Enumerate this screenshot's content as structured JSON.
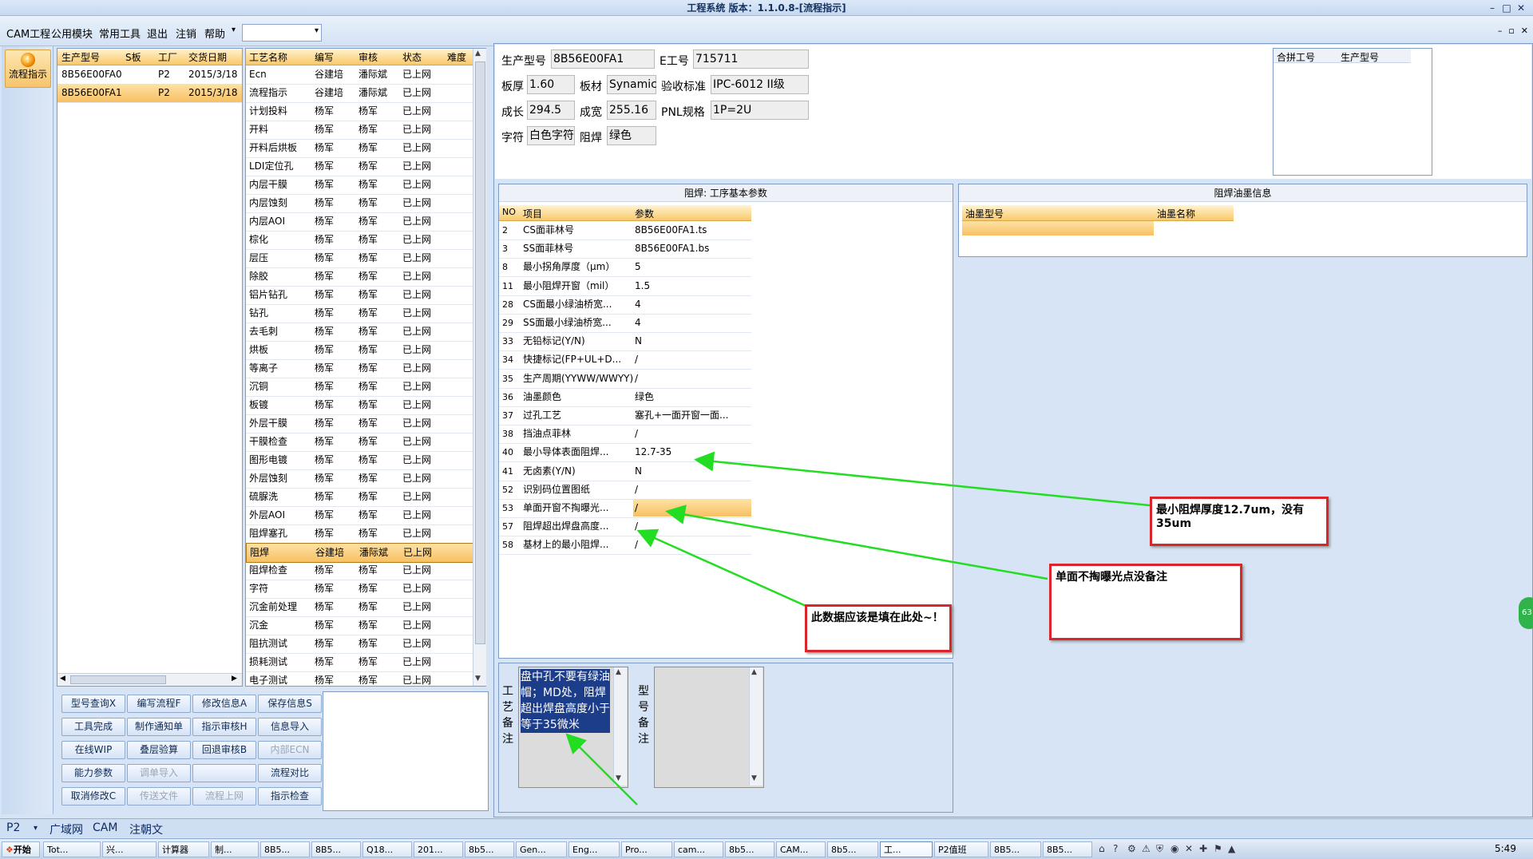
{
  "window": {
    "title": "工程系统 版本：1.1.0.8-[流程指示]"
  },
  "menu": {
    "items": [
      "CAM工程",
      "公用模块",
      "常用工具",
      "退出",
      "注销",
      "帮助"
    ],
    "combo_value": ""
  },
  "nav": {
    "label": "流程指示",
    "icon": "warning-orb-icon"
  },
  "product_list": {
    "headers": [
      "生产型号",
      "S板",
      "工厂",
      "交货日期"
    ],
    "rows": [
      [
        "8B56E00FA0",
        "",
        "P2",
        "2015/3/18"
      ],
      [
        "8B56E00FA1",
        "",
        "P2",
        "2015/3/18"
      ]
    ],
    "selected_index": 1
  },
  "process_list": {
    "headers": [
      "工艺名称",
      "编写",
      "审核",
      "状态",
      "难度"
    ],
    "rows": [
      [
        "Ecn",
        "谷建培",
        "潘际斌",
        "已上网"
      ],
      [
        "流程指示",
        "谷建培",
        "潘际斌",
        "已上网"
      ],
      [
        "计划投料",
        "杨军",
        "杨军",
        "已上网"
      ],
      [
        "开料",
        "杨军",
        "杨军",
        "已上网"
      ],
      [
        "开料后烘板",
        "杨军",
        "杨军",
        "已上网"
      ],
      [
        "LDI定位孔",
        "杨军",
        "杨军",
        "已上网"
      ],
      [
        "内层干膜",
        "杨军",
        "杨军",
        "已上网"
      ],
      [
        "内层蚀刻",
        "杨军",
        "杨军",
        "已上网"
      ],
      [
        "内层AOI",
        "杨军",
        "杨军",
        "已上网"
      ],
      [
        "棕化",
        "杨军",
        "杨军",
        "已上网"
      ],
      [
        "层压",
        "杨军",
        "杨军",
        "已上网"
      ],
      [
        "除胶",
        "杨军",
        "杨军",
        "已上网"
      ],
      [
        "铝片钻孔",
        "杨军",
        "杨军",
        "已上网"
      ],
      [
        "钻孔",
        "杨军",
        "杨军",
        "已上网"
      ],
      [
        "去毛刺",
        "杨军",
        "杨军",
        "已上网"
      ],
      [
        "烘板",
        "杨军",
        "杨军",
        "已上网"
      ],
      [
        "等离子",
        "杨军",
        "杨军",
        "已上网"
      ],
      [
        "沉铜",
        "杨军",
        "杨军",
        "已上网"
      ],
      [
        "板镀",
        "杨军",
        "杨军",
        "已上网"
      ],
      [
        "外层干膜",
        "杨军",
        "杨军",
        "已上网"
      ],
      [
        "干膜检查",
        "杨军",
        "杨军",
        "已上网"
      ],
      [
        "图形电镀",
        "杨军",
        "杨军",
        "已上网"
      ],
      [
        "外层蚀刻",
        "杨军",
        "杨军",
        "已上网"
      ],
      [
        "硫脲洗",
        "杨军",
        "杨军",
        "已上网"
      ],
      [
        "外层AOI",
        "杨军",
        "杨军",
        "已上网"
      ],
      [
        "阻焊塞孔",
        "杨军",
        "杨军",
        "已上网"
      ],
      [
        "阻焊",
        "谷建培",
        "潘际斌",
        "已上网"
      ],
      [
        "阻焊检查",
        "杨军",
        "杨军",
        "已上网"
      ],
      [
        "字符",
        "杨军",
        "杨军",
        "已上网"
      ],
      [
        "沉金前处理",
        "杨军",
        "杨军",
        "已上网"
      ],
      [
        "沉金",
        "杨军",
        "杨军",
        "已上网"
      ],
      [
        "阻抗测试",
        "杨军",
        "杨军",
        "已上网"
      ],
      [
        "损耗测试",
        "杨军",
        "杨军",
        "已上网"
      ],
      [
        "电子测试",
        "杨军",
        "杨军",
        "已上网"
      ]
    ],
    "selected_index": 26
  },
  "buttons": [
    [
      {
        "label": "型号查询X"
      },
      {
        "label": "编写流程F"
      },
      {
        "label": "修改信息A"
      },
      {
        "label": "保存信息S"
      }
    ],
    [
      {
        "label": "工具完成"
      },
      {
        "label": "制作通知单"
      },
      {
        "label": "指示审核H"
      },
      {
        "label": "信息导入"
      }
    ],
    [
      {
        "label": "在线WIP"
      },
      {
        "label": "叠层验算"
      },
      {
        "label": "回退审核B"
      },
      {
        "label": "内部ECN",
        "disabled": true
      }
    ],
    [
      {
        "label": "能力参数"
      },
      {
        "label": "调单导入",
        "disabled": true
      },
      {
        "label": ""
      },
      {
        "label": "流程对比"
      }
    ],
    [
      {
        "label": "取消修改C"
      },
      {
        "label": "传送文件",
        "disabled": true
      },
      {
        "label": "流程上网",
        "disabled": true
      },
      {
        "label": "指示检查"
      }
    ]
  ],
  "info": {
    "prod_model_label": "生产型号",
    "prod_model": "8B56E00FA1",
    "e_no_label": "E工号",
    "e_no": "715711",
    "thickness_label": "板厚",
    "thickness": "1.60",
    "material_label": "板材",
    "material": "Synamic",
    "standard_label": "验收标准",
    "standard": "IPC-6012 II级",
    "length_label": "成长",
    "length": "294.5",
    "width_label": "成宽",
    "width": "255.16",
    "pnl_label": "PNL规格",
    "pnl": "1P=2U",
    "char_label": "字符",
    "char": "白色字符",
    "mask_label": "阻焊",
    "mask": "绿色"
  },
  "merge_table": {
    "headers": [
      "合拼工号",
      "生产型号"
    ]
  },
  "params": {
    "title": "阻焊: 工序基本参数",
    "headers": [
      "NO",
      "项目",
      "参数"
    ],
    "rows": [
      [
        "2",
        "CS面菲林号",
        "8B56E00FA1.ts"
      ],
      [
        "3",
        "SS面菲林号",
        "8B56E00FA1.bs"
      ],
      [
        "8",
        "最小拐角厚度（μm）",
        "5"
      ],
      [
        "11",
        "最小阻焊开窗（mil）",
        "1.5"
      ],
      [
        "28",
        "CS面最小绿油桥宽...",
        "4"
      ],
      [
        "29",
        "SS面最小绿油桥宽...",
        "4"
      ],
      [
        "33",
        "无铅标记(Y/N)",
        "N"
      ],
      [
        "34",
        "快捷标记(FP+UL+D...",
        "/"
      ],
      [
        "35",
        "生产周期(YYWW/WWYY)",
        "/"
      ],
      [
        "36",
        "油墨颜色",
        "绿色"
      ],
      [
        "37",
        "过孔工艺",
        "塞孔+一面开窗一面..."
      ],
      [
        "38",
        "挡油点菲林",
        "/"
      ],
      [
        "40",
        "最小导体表面阻焊...",
        "12.7-35"
      ],
      [
        "41",
        "无卤素(Y/N)",
        "N"
      ],
      [
        "52",
        "识别码位置图纸",
        "/"
      ],
      [
        "53",
        "单面开窗不掏曝光...",
        "/"
      ],
      [
        "57",
        "阻焊超出焊盘高度...",
        "/"
      ],
      [
        "58",
        "基材上的最小阻焊...",
        "/"
      ]
    ],
    "selected_index": 15
  },
  "ink": {
    "title": "阻焊油墨信息",
    "headers": [
      "油墨型号",
      "油墨名称"
    ]
  },
  "remarks": {
    "process_label": [
      "工",
      "艺",
      "备",
      "注"
    ],
    "process_text": "盘中孔不要有绿油帽；MD处，阻焊超出焊盘高度小于等于35微米",
    "model_label": [
      "型",
      "号",
      "备",
      "注"
    ]
  },
  "annotations": {
    "note1": "最小阻焊厚度12.7um，没有35um",
    "note2": "单面不掏曝光点没备注",
    "note3": "此数据应该是填在此处~！"
  },
  "statusbar": {
    "plant": "P2",
    "tabs": [
      "广域网",
      "CAM",
      "注朝文"
    ]
  },
  "taskbar": {
    "start": "开始",
    "items": [
      "Tot...",
      "兴...",
      "计算器",
      "制...",
      "8B5...",
      "8B5...",
      "Q18...",
      "201...",
      "8b5...",
      "Gen...",
      "Eng...",
      "Pro...",
      "cam...",
      "8b5...",
      "CAM...",
      "8b5...",
      "工...",
      "P2值班",
      "8B5...",
      "8B5..."
    ],
    "active_index": 16,
    "clock": "5:49"
  },
  "colors": {
    "selection": "#f8c063",
    "annotation_border": "#d9262c",
    "arrow": "#22dd22",
    "header_bg": "#f9c96b"
  }
}
